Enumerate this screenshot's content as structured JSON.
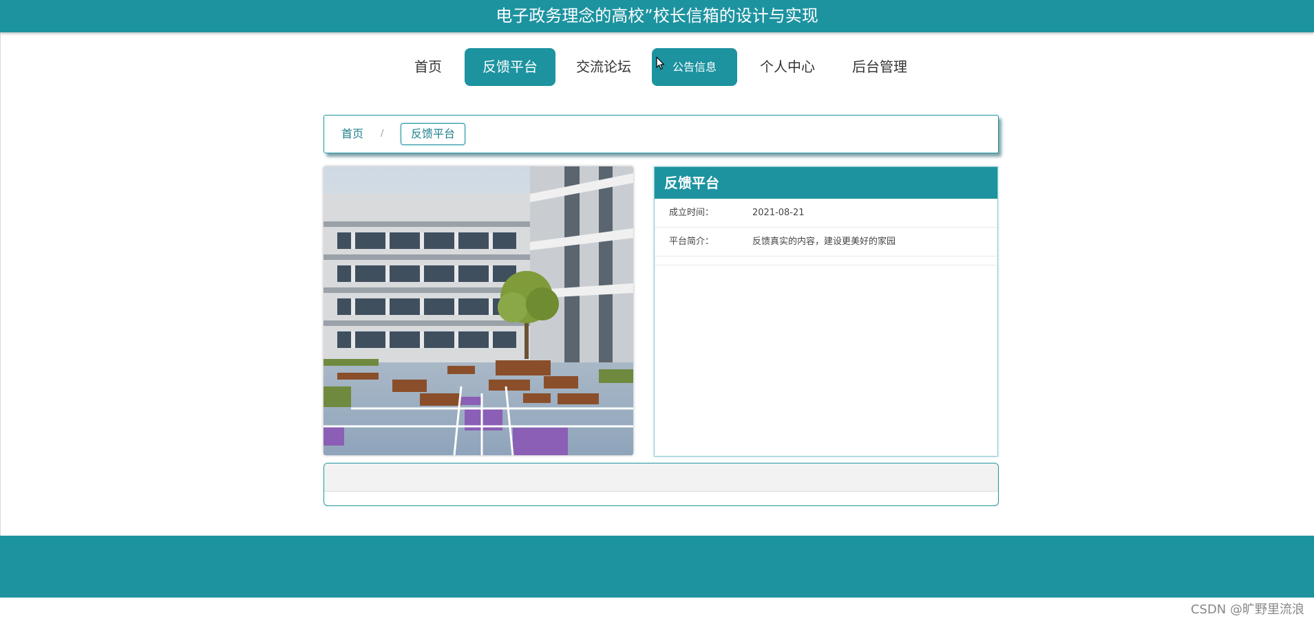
{
  "header": {
    "title": "电子政务理念的高校”校长信箱的设计与实现"
  },
  "nav": {
    "items": [
      {
        "label": "首页"
      },
      {
        "label": "反馈平台"
      },
      {
        "label": "交流论坛"
      },
      {
        "label": "公告信息"
      },
      {
        "label": "个人中心"
      },
      {
        "label": "后台管理"
      }
    ],
    "active": "反馈平台"
  },
  "breadcrumb": {
    "home": "首页",
    "separator": "/",
    "current": "反馈平台"
  },
  "info": {
    "title": "反馈平台",
    "rows": [
      {
        "label": "成立时间：",
        "value": "2021-08-21"
      },
      {
        "label": "平台简介：",
        "value": "反馈真实的内容，建设更美好的家园"
      }
    ]
  },
  "watermark": "CSDN @旷野里流浪",
  "colors": {
    "primary": "#1d93a0",
    "text": "#333333"
  },
  "icons": {
    "cursor": "mouse-pointer-icon"
  }
}
